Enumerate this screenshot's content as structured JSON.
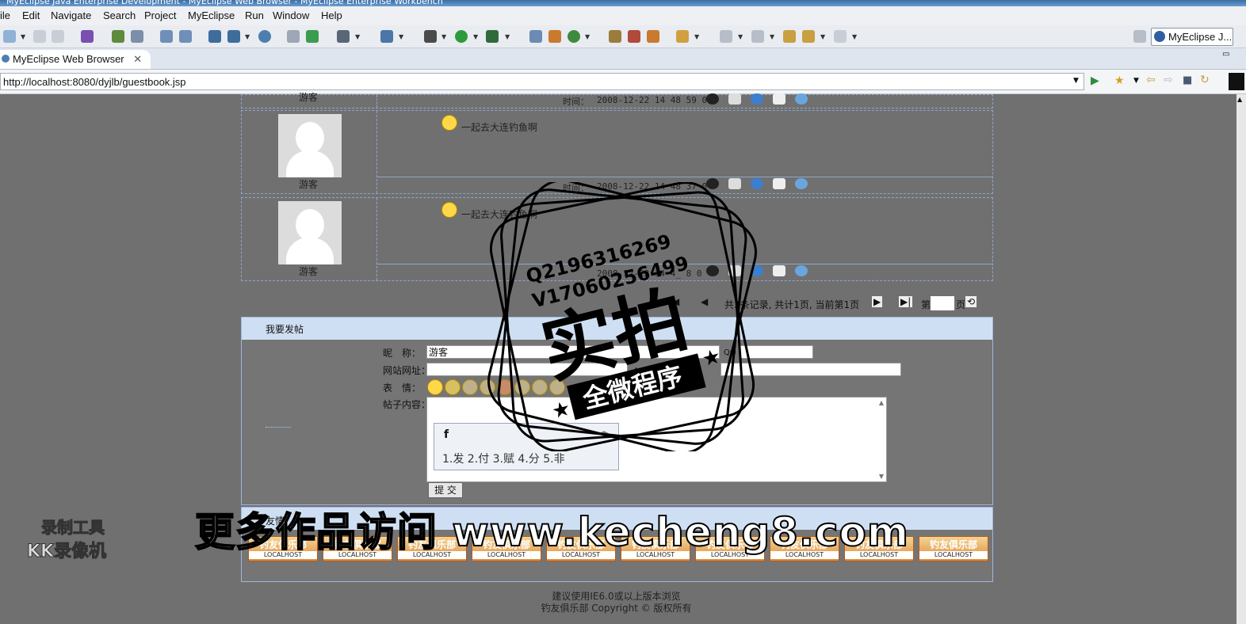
{
  "window": {
    "title": "MyEclipse Java Enterprise Development - MyEclipse Web Browser - MyEclipse Enterprise Workbench"
  },
  "menu": {
    "items": [
      "ile",
      "Edit",
      "Navigate",
      "Search",
      "Project",
      "MyEclipse",
      "Run",
      "Window",
      "Help"
    ]
  },
  "toolbar": {
    "perspective_label": "MyEclipse J..."
  },
  "editor_tab": {
    "label": "MyEclipse Web Browser"
  },
  "browser": {
    "url": "http://localhost:8080/dyjlb/guestbook.jsp"
  },
  "posts": [
    {
      "nick": "游客",
      "text": "",
      "time_label": "时间：",
      "time": "2008-12-22 14 48 59 0"
    },
    {
      "nick": "游客",
      "text": "一起去大连钓鱼啊",
      "time_label": "时间：",
      "time": "2008-12-22 14 48 37 0"
    },
    {
      "nick": "游客",
      "text": "一起去大连钓鱼啊",
      "time_label": "时间：",
      "time": "2008-12-22 14 4_ 8 0"
    }
  ],
  "pager": {
    "text": "共3条记录, 共计1页, 当前第1页",
    "page_prefix": "第",
    "page_suffix": "页"
  },
  "form": {
    "title": "我要发帖",
    "nick_label": "昵　称：",
    "nick_value": "游客",
    "qq_label": "QQ",
    "site_label": "网站网址：",
    "site_hint": "个人网",
    "mood_label": "表　情：",
    "content_label": "帖子内容：",
    "ime_input": "f",
    "ime_candidates": "1.发  2.付  3.赋  4.分  5.非",
    "submit_label": "提 交"
  },
  "links": {
    "header": "友情",
    "badges": [
      {
        "title": "钓友俱乐部",
        "sub": "LOCALHOST"
      },
      {
        "title": "钓友俱乐部",
        "sub": "LOCALHOST"
      },
      {
        "title": "钓友俱乐部",
        "sub": "LOCALHOST"
      },
      {
        "title": "钓友俱乐部",
        "sub": "LOCALHOST"
      },
      {
        "title": "钓友俱乐部",
        "sub": "LOCALHOST"
      },
      {
        "title": "钓友俱乐部",
        "sub": "LOCALHOST"
      },
      {
        "title": "钓友俱乐部",
        "sub": "LOCALHOST"
      },
      {
        "title": "钓友俱乐部",
        "sub": "LOCALHOST"
      },
      {
        "title": "钓友俱乐部",
        "sub": "LOCALHOST"
      },
      {
        "title": "钓友俱乐部",
        "sub": "LOCALHOST"
      }
    ]
  },
  "footer": {
    "line1": "建议使用IE6.0或以上版本浏览",
    "line2": "钓友俱乐部 Copyright © 版权所有"
  },
  "overlay": {
    "stamp_qq": "Q2196316269",
    "stamp_v": "V17060256499",
    "stamp_main": "实拍",
    "stamp_sub": "全微程序",
    "watermark": "更多作品访问 www.kecheng8.com",
    "recorder_line1": "录制工具",
    "recorder_line2": "KK录像机"
  },
  "colors": {
    "page_bg": "#707070",
    "header_blue": "#cfdff3",
    "border_blue": "#8fa6c8"
  }
}
